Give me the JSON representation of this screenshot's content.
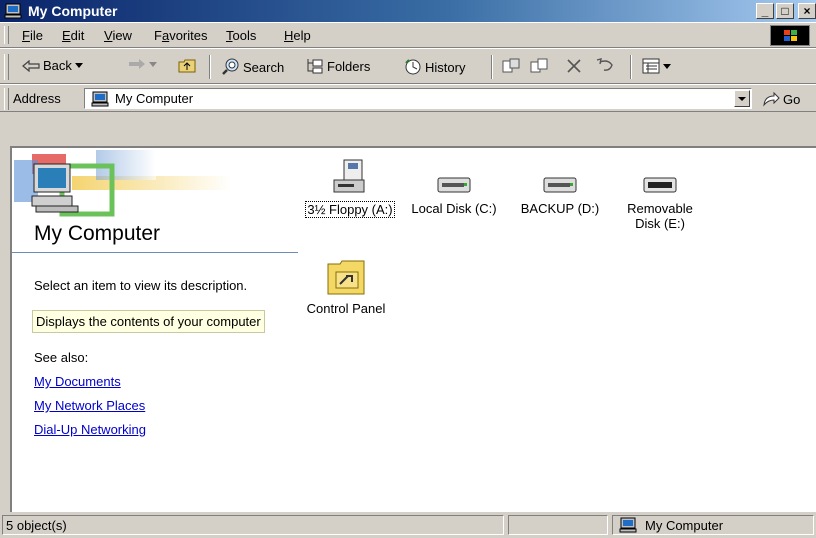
{
  "window": {
    "title": "My Computer"
  },
  "menu": [
    "File",
    "Edit",
    "View",
    "Favorites",
    "Tools",
    "Help"
  ],
  "menu_underlines": [
    "F",
    "E",
    "V",
    "a",
    "T",
    "H"
  ],
  "toolbar": {
    "back": "Back",
    "search": "Search",
    "folders": "Folders",
    "history": "History"
  },
  "address": {
    "label": "Address",
    "value": "My Computer",
    "go": "Go"
  },
  "panel": {
    "title": "My Computer",
    "instruction": "Select an item to view its description.",
    "info": "Displays the contents of your computer",
    "see_also": "See also:",
    "links": [
      "My Documents",
      "My Network Places",
      "Dial-Up Networking"
    ]
  },
  "items": [
    {
      "label": "3½ Floppy (A:)",
      "icon": "floppy-drive-icon"
    },
    {
      "label": "Local Disk (C:)",
      "icon": "hard-disk-icon"
    },
    {
      "label": "BACKUP (D:)",
      "icon": "hard-disk-icon"
    },
    {
      "label": "Removable Disk (E:)",
      "label_line1": "Removable",
      "label_line2": "Disk (E:)",
      "icon": "removable-disk-icon"
    },
    {
      "label": "Control Panel",
      "icon": "control-panel-icon"
    }
  ],
  "status": {
    "count": "5 object(s)",
    "zone": "My Computer"
  }
}
